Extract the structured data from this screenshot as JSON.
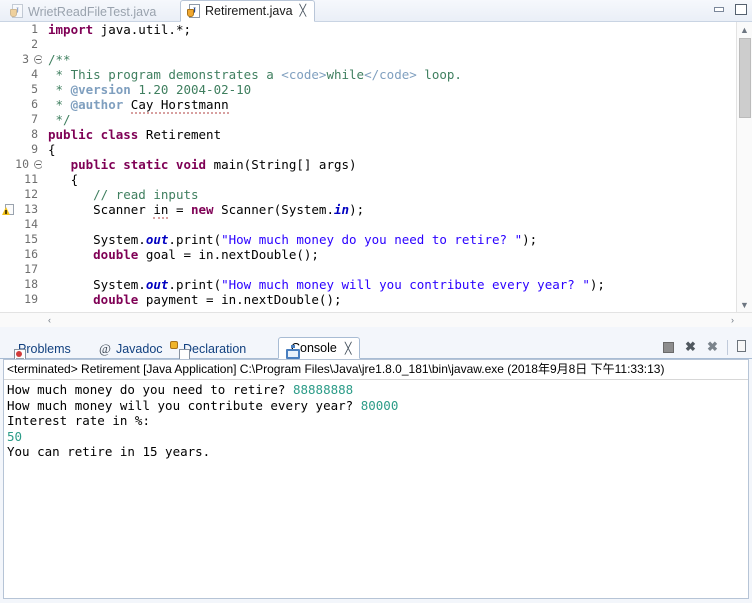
{
  "window": {
    "minimize_label": "Minimize",
    "maximize_label": "Maximize"
  },
  "editor": {
    "tabs": [
      {
        "label": "WrietReadFileTest.java",
        "active": false,
        "icon": "java-file-icon"
      },
      {
        "label": "Retirement.java",
        "active": true,
        "icon": "java-file-icon",
        "close": "╳"
      }
    ],
    "lines": [
      {
        "num": "1",
        "fold": false,
        "marker": "none",
        "tokens": [
          {
            "t": "kw",
            "v": "import"
          },
          {
            "t": "pln",
            "v": " java.util.*;"
          }
        ]
      },
      {
        "num": "2",
        "fold": false,
        "marker": "none",
        "tokens": [
          {
            "t": "pln",
            "v": ""
          }
        ]
      },
      {
        "num": "3",
        "fold": true,
        "marker": "none",
        "tokens": [
          {
            "t": "jdoc",
            "v": "/**"
          }
        ]
      },
      {
        "num": "4",
        "fold": false,
        "marker": "none",
        "tokens": [
          {
            "t": "jdoc",
            "v": " * This program demonstrates a "
          },
          {
            "t": "jtag",
            "v": "<code>"
          },
          {
            "t": "jdoc",
            "v": "while"
          },
          {
            "t": "jtag",
            "v": "</code>"
          },
          {
            "t": "jdoc",
            "v": " loop."
          }
        ]
      },
      {
        "num": "5",
        "fold": false,
        "marker": "none",
        "tokens": [
          {
            "t": "jdoc",
            "v": " * "
          },
          {
            "t": "jkey",
            "v": "@version"
          },
          {
            "t": "jdoc",
            "v": " 1.20 2004-02-10"
          }
        ]
      },
      {
        "num": "6",
        "fold": false,
        "marker": "none",
        "tokens": [
          {
            "t": "jdoc",
            "v": " * "
          },
          {
            "t": "jkey",
            "v": "@author"
          },
          {
            "t": "jdoc",
            "v": " "
          },
          {
            "t": "sqg",
            "v": "Cay Horstmann"
          }
        ]
      },
      {
        "num": "7",
        "fold": false,
        "marker": "none",
        "tokens": [
          {
            "t": "jdoc",
            "v": " */"
          }
        ]
      },
      {
        "num": "8",
        "fold": false,
        "marker": "none",
        "tokens": [
          {
            "t": "kw",
            "v": "public class"
          },
          {
            "t": "pln",
            "v": " Retirement"
          }
        ]
      },
      {
        "num": "9",
        "fold": false,
        "marker": "none",
        "tokens": [
          {
            "t": "pln",
            "v": "{"
          }
        ]
      },
      {
        "num": "10",
        "fold": true,
        "marker": "none",
        "tokens": [
          {
            "t": "pln",
            "v": "   "
          },
          {
            "t": "kw",
            "v": "public static void"
          },
          {
            "t": "pln",
            "v": " main(String[] args)"
          }
        ]
      },
      {
        "num": "11",
        "fold": false,
        "marker": "none",
        "tokens": [
          {
            "t": "pln",
            "v": "   {"
          }
        ]
      },
      {
        "num": "12",
        "fold": false,
        "marker": "none",
        "tokens": [
          {
            "t": "pln",
            "v": "      "
          },
          {
            "t": "cmt",
            "v": "// read inputs"
          }
        ]
      },
      {
        "num": "13",
        "fold": false,
        "marker": "warning",
        "tokens": [
          {
            "t": "pln",
            "v": "      Scanner "
          },
          {
            "t": "sqg",
            "v": "in"
          },
          {
            "t": "pln",
            "v": " = "
          },
          {
            "t": "kw",
            "v": "new"
          },
          {
            "t": "pln",
            "v": " Scanner(System."
          },
          {
            "t": "fld",
            "v": "in"
          },
          {
            "t": "pln",
            "v": ");"
          }
        ]
      },
      {
        "num": "14",
        "fold": false,
        "marker": "none",
        "tokens": [
          {
            "t": "pln",
            "v": ""
          }
        ]
      },
      {
        "num": "15",
        "fold": false,
        "marker": "none",
        "tokens": [
          {
            "t": "pln",
            "v": "      System."
          },
          {
            "t": "fld",
            "v": "out"
          },
          {
            "t": "pln",
            "v": ".print("
          },
          {
            "t": "str",
            "v": "\"How much money do you need to retire? \""
          },
          {
            "t": "pln",
            "v": ");"
          }
        ]
      },
      {
        "num": "16",
        "fold": false,
        "marker": "none",
        "tokens": [
          {
            "t": "pln",
            "v": "      "
          },
          {
            "t": "kw",
            "v": "double"
          },
          {
            "t": "pln",
            "v": " goal = in.nextDouble();"
          }
        ]
      },
      {
        "num": "17",
        "fold": false,
        "marker": "none",
        "tokens": [
          {
            "t": "pln",
            "v": ""
          }
        ]
      },
      {
        "num": "18",
        "fold": false,
        "marker": "none",
        "tokens": [
          {
            "t": "pln",
            "v": "      System."
          },
          {
            "t": "fld",
            "v": "out"
          },
          {
            "t": "pln",
            "v": ".print("
          },
          {
            "t": "str",
            "v": "\"How much money will you contribute every year? \""
          },
          {
            "t": "pln",
            "v": ");"
          }
        ]
      },
      {
        "num": "19",
        "fold": false,
        "marker": "none",
        "tokens": [
          {
            "t": "pln",
            "v": "      "
          },
          {
            "t": "kw",
            "v": "double"
          },
          {
            "t": "pln",
            "v": " payment = in.nextDouble();"
          }
        ]
      }
    ],
    "scroll": {
      "up_arrow": "▲",
      "down_arrow": "▼",
      "left_arrow": "‹",
      "right_arrow": "›"
    }
  },
  "bottom_view": {
    "tabs": [
      {
        "label": "Problems",
        "active": false,
        "icon": "problems-icon"
      },
      {
        "label": "Javadoc",
        "active": false,
        "icon": "javadoc-at-icon"
      },
      {
        "label": "Declaration",
        "active": false,
        "icon": "declaration-icon"
      },
      {
        "label": "Console",
        "active": true,
        "icon": "console-icon",
        "close": "╳"
      }
    ],
    "toolbar": [
      {
        "name": "terminate-button",
        "label": "Terminate"
      },
      {
        "name": "remove-launch-button",
        "label": "Remove Launch"
      },
      {
        "name": "remove-all-terminated-button",
        "label": "Remove All Terminated Launches"
      },
      {
        "name": "toolbar-separator",
        "label": ""
      },
      {
        "name": "pin-console-button",
        "label": "Pin Console"
      }
    ]
  },
  "console": {
    "header": "<terminated> Retirement [Java Application] C:\\Program Files\\Java\\jre1.8.0_181\\bin\\javaw.exe (2018年9月8日 下午11:33:13)",
    "accent_input_color": "#2c9c88",
    "output": [
      {
        "segments": [
          {
            "kind": "out",
            "text": "How much money do you need to retire? "
          },
          {
            "kind": "in",
            "text": "88888888"
          }
        ]
      },
      {
        "segments": [
          {
            "kind": "out",
            "text": "How much money will you contribute every year? "
          },
          {
            "kind": "in",
            "text": "80000"
          }
        ]
      },
      {
        "segments": [
          {
            "kind": "out",
            "text": "Interest rate in %:"
          }
        ]
      },
      {
        "segments": [
          {
            "kind": "in",
            "text": "50"
          }
        ]
      },
      {
        "segments": [
          {
            "kind": "out",
            "text": "You can retire in 15 years."
          }
        ]
      }
    ]
  }
}
